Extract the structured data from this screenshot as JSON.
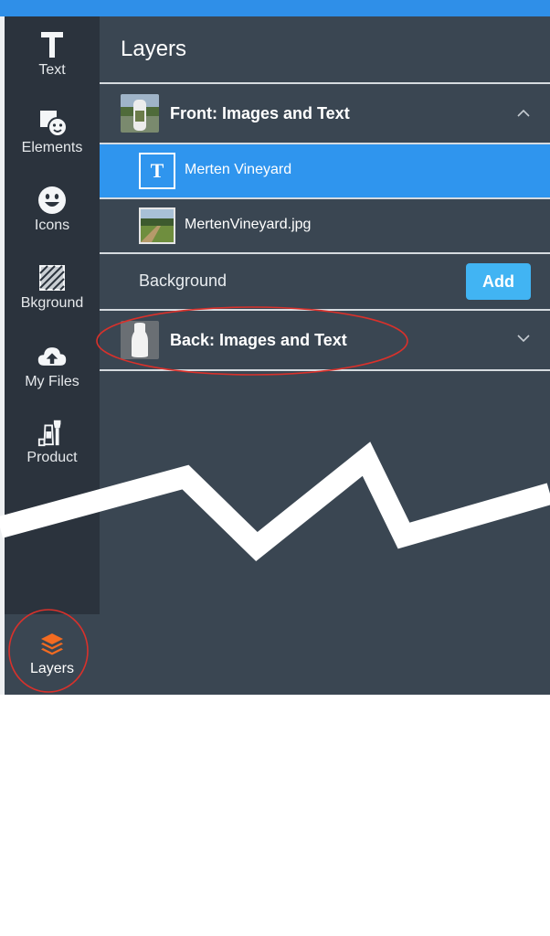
{
  "sidebar": {
    "items": [
      {
        "label": "Text",
        "icon": "text-icon"
      },
      {
        "label": "Elements",
        "icon": "elements-icon"
      },
      {
        "label": "Icons",
        "icon": "smiley-icon"
      },
      {
        "label": "Bkground",
        "icon": "background-pattern-icon"
      },
      {
        "label": "My Files",
        "icon": "cloud-upload-icon"
      },
      {
        "label": "Product",
        "icon": "product-icon"
      }
    ],
    "active": {
      "label": "Layers",
      "icon": "layers-icon",
      "color": "#f36b21"
    }
  },
  "panel": {
    "title": "Layers",
    "groups": [
      {
        "title": "Front: Images and Text",
        "expanded": true,
        "layers": [
          {
            "label": "Merten Vineyard",
            "type": "text",
            "selected": true
          },
          {
            "label": "MertenVineyard.jpg",
            "type": "image",
            "selected": false
          }
        ]
      },
      {
        "title": "Back: Images and Text",
        "expanded": false
      }
    ],
    "background": {
      "label": "Background",
      "button_label": "Add"
    }
  },
  "colors": {
    "sidebar_bg": "#2b333d",
    "panel_bg": "#3a4652",
    "selected_row": "#2f95ee",
    "add_button": "#41b4f3",
    "annotation_red": "#d9312b",
    "top_bar": "#2f8fe8"
  }
}
